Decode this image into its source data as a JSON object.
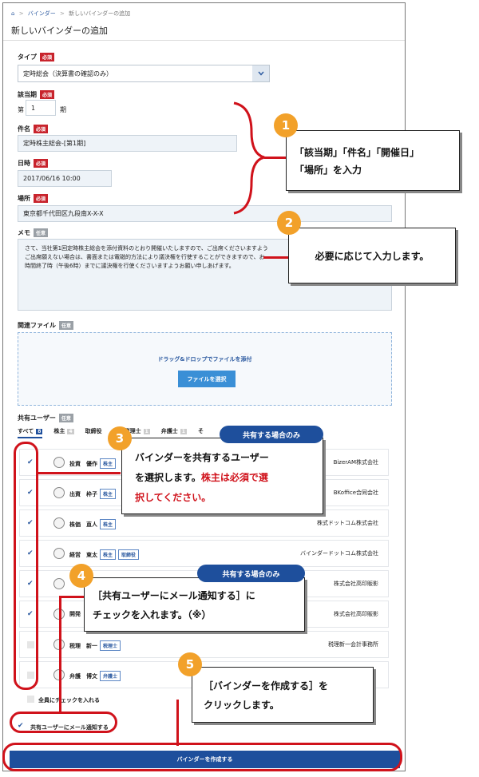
{
  "breadcrumb": {
    "home": "⌂",
    "sep1": ">",
    "item1": "バインダー",
    "sep2": ">",
    "item2": "新しいバインダーの追加"
  },
  "page_title": "新しいバインダーの追加",
  "badges": {
    "required": "必須",
    "optional": "任意"
  },
  "type": {
    "label": "タイプ",
    "value": "定時総会（決算書の確認のみ）"
  },
  "period": {
    "label": "該当期",
    "prefix": "第",
    "value": "1",
    "suffix": "期"
  },
  "subject": {
    "label": "件名",
    "value": "定時株主総会-[第1期]"
  },
  "datetime": {
    "label": "日時",
    "value": "2017/06/16 10:00"
  },
  "place": {
    "label": "場所",
    "value": "東京都千代田区九段南X-X-X"
  },
  "memo": {
    "label": "メモ",
    "lines": [
      "さて、当社第1回定時株主総会を添付資料のとおり開催いたしますので、ご出席くださいますよう",
      "ご出席願えない場合は、書面または電磁的方法により議決権を行使することができますので、お",
      "時間終了時（午後6時）までに議決権を行使くださいますようお願い申しあげます。"
    ]
  },
  "files": {
    "label": "関連ファイル",
    "drop_text": "ドラッグ&ドロップでファイルを添付",
    "button": "ファイルを選択"
  },
  "shared_users": {
    "label": "共有ユーザー",
    "tabs": [
      {
        "label": "すべて",
        "count": "8"
      },
      {
        "label": "株主",
        "count": "4"
      },
      {
        "label": "取締役",
        "count": ""
      },
      {
        "label": "税理士",
        "count": "1"
      },
      {
        "label": "弁護士",
        "count": "1"
      },
      {
        "label": "そ",
        "count": ""
      }
    ],
    "users": [
      {
        "name": "投資　優作",
        "tags": [
          "株主"
        ],
        "company": "BizerAM株式会社",
        "checked": true
      },
      {
        "name": "出資　枠子",
        "tags": [
          "株主"
        ],
        "company": "BKoffice合同会社",
        "checked": true
      },
      {
        "name": "株価　直人",
        "tags": [
          "株主"
        ],
        "company": "株式ドットコム株式会社",
        "checked": true
      },
      {
        "name": "経営　東太",
        "tags": [
          "株主",
          "取締役"
        ],
        "company": "バインダードットコム株式会社",
        "checked": true
      },
      {
        "name": "",
        "tags": [],
        "company": "株式会社高印販影",
        "checked": true
      },
      {
        "name": "開発",
        "tags": [],
        "company": "株式会社高印販影",
        "checked": true
      },
      {
        "name": "税理　新一",
        "tags": [
          "税理士"
        ],
        "company": "税理新一会計事務所",
        "checked": false
      },
      {
        "name": "弁護　博文",
        "tags": [
          "弁護士"
        ],
        "company": "",
        "checked": false
      }
    ],
    "check_all": "全員にチェックを入れる",
    "notify": "共有ユーザーにメール通知する"
  },
  "submit_button": "バインダーを作成する",
  "check_mark": "✔",
  "callouts": {
    "c1": {
      "num": "1",
      "line1": "「該当期」「件名」「開催日」",
      "line2": "「場所」を入力"
    },
    "c2": {
      "num": "2",
      "text": "必要に応じて入力します。"
    },
    "c3": {
      "num": "3",
      "pill": "共有する場合のみ",
      "line1": "バインダーを共有するユーザー",
      "line2a": "を選択します。",
      "line2b": "株主は必須で選",
      "line3": "択してください。"
    },
    "c4": {
      "num": "4",
      "pill": "共有する場合のみ",
      "line1": "［共有ユーザーにメール通知する］に",
      "line2": "チェックを入れます。（※）"
    },
    "c5": {
      "num": "5",
      "line1": "［バインダーを作成する］を",
      "line2": "クリックします。"
    }
  },
  "colors": {
    "accent": "#1e4f9c",
    "required": "#c8232c",
    "highlight": "#d0121b",
    "callout_num": "#f2a12a"
  }
}
